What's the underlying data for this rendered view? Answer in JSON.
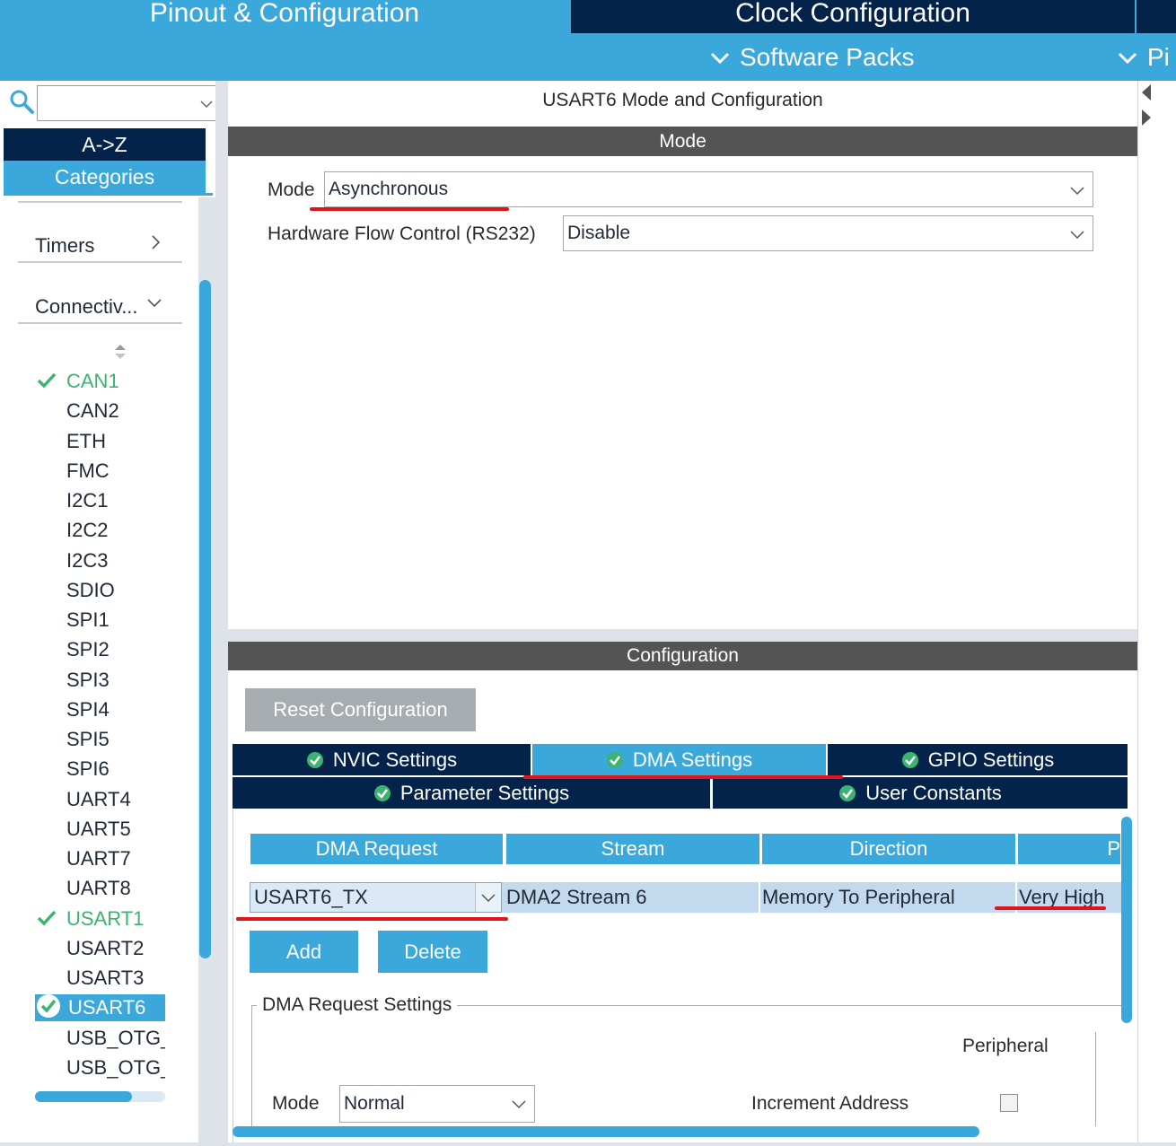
{
  "top_tabs": {
    "pinout": "Pinout & Configuration",
    "clock": "Clock Configuration"
  },
  "subbar": {
    "software_packs": "Software Packs",
    "pinout_short": "Pi"
  },
  "sidebar": {
    "search_placeholder": "",
    "az_label": "A->Z",
    "categories_label": "Categories",
    "groups": {
      "timers": "Timers",
      "connectivity": "Connectiv..."
    },
    "items": [
      {
        "label": "CAN1",
        "status": "enabled"
      },
      {
        "label": "CAN2",
        "status": ""
      },
      {
        "label": "ETH",
        "status": ""
      },
      {
        "label": "FMC",
        "status": ""
      },
      {
        "label": "I2C1",
        "status": ""
      },
      {
        "label": "I2C2",
        "status": ""
      },
      {
        "label": "I2C3",
        "status": ""
      },
      {
        "label": "SDIO",
        "status": ""
      },
      {
        "label": "SPI1",
        "status": ""
      },
      {
        "label": "SPI2",
        "status": ""
      },
      {
        "label": "SPI3",
        "status": ""
      },
      {
        "label": "SPI4",
        "status": ""
      },
      {
        "label": "SPI5",
        "status": ""
      },
      {
        "label": "SPI6",
        "status": ""
      },
      {
        "label": "UART4",
        "status": ""
      },
      {
        "label": "UART5",
        "status": ""
      },
      {
        "label": "UART7",
        "status": ""
      },
      {
        "label": "UART8",
        "status": ""
      },
      {
        "label": "USART1",
        "status": "enabled"
      },
      {
        "label": "USART2",
        "status": ""
      },
      {
        "label": "USART3",
        "status": ""
      },
      {
        "label": "USART6",
        "status": "selected"
      },
      {
        "label": "USB_OTG_FS",
        "status": ""
      },
      {
        "label": "USB_OTG_HS",
        "status": ""
      }
    ]
  },
  "mode_panel": {
    "title": "USART6 Mode and Configuration",
    "section": "Mode",
    "mode_label": "Mode",
    "mode_value": "Asynchronous",
    "flow_label": "Hardware Flow Control (RS232)",
    "flow_value": "Disable"
  },
  "config_panel": {
    "section": "Configuration",
    "reset_button": "Reset Configuration",
    "tabs": {
      "nvic": "NVIC Settings",
      "dma": "DMA Settings",
      "gpio": "GPIO Settings",
      "params": "Parameter Settings",
      "user_constants": "User Constants"
    },
    "active_tab": "DMA Settings",
    "dma_table": {
      "headers": [
        "DMA Request",
        "Stream",
        "Direction",
        "P"
      ],
      "rows": [
        {
          "request": "USART6_TX",
          "stream": "DMA2 Stream 6",
          "direction": "Memory To Peripheral",
          "priority": "Very High"
        }
      ]
    },
    "add_button": "Add",
    "delete_button": "Delete",
    "request_settings": {
      "legend": "DMA Request Settings",
      "peripheral_header": "Peripheral",
      "mode_label": "Mode",
      "mode_value": "Normal",
      "increment_label": "Increment Address",
      "peripheral_increment": false
    }
  },
  "colors": {
    "accent": "#3ba8dc",
    "navy": "#03234b",
    "section_bar": "#545454",
    "ok_green": "#3cb371",
    "annotation_red": "#e0151a"
  }
}
